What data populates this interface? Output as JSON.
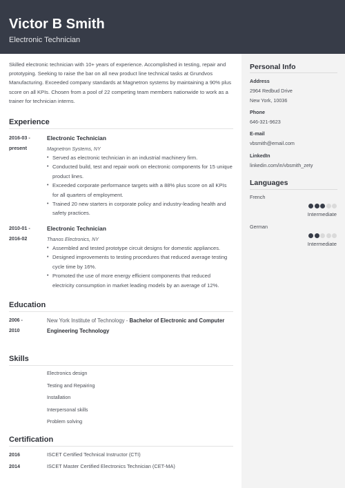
{
  "header": {
    "name": "Victor B Smith",
    "title": "Electronic Technician"
  },
  "summary": "Skilled electronic technician with 10+ years of experience. Accomplished in testing, repair and prototyping. Seeking to raise the bar on all new product line technical tasks at Grundvos Manufacturing. Exceeded company standards at Magnetron systems by maintaining a 90% plus score on all KPIs. Chosen from a pool of 22 competing team members nationwide to work as a trainer for technician interns.",
  "experience": {
    "heading": "Experience",
    "jobs": [
      {
        "date_start": "2016-03 -",
        "date_end": "present",
        "title": "Electronic Technician",
        "company": "Magnetron Systems, NY",
        "bullets": [
          "Served as electronic technician in an industrial machinery firm.",
          "Conducted build, test and repair work on electronic components for 15 unique product lines.",
          "Exceeded corporate performance targets with a 88% plus score on all KPIs for all quarters of employment.",
          "Trained 20 new starters in corporate policy and industry-leading health and safety practices."
        ]
      },
      {
        "date_start": "2010-01 -",
        "date_end": "2016-02",
        "title": "Electronic Technician",
        "company": "Thanos Electronics, NY",
        "bullets": [
          "Assembled and tested prototype circuit designs for domestic appliances.",
          "Designed improvements to testing procedures that reduced average testing cycle time by 16%.",
          "Promoted the use of more energy efficient components that reduced electricity consumption in market leading models by an average of 12%."
        ]
      }
    ]
  },
  "education": {
    "heading": "Education",
    "items": [
      {
        "date_start": "2006 -",
        "date_end": "2010",
        "school": "New York Institute of Technology - ",
        "degree": "Bachelor of Electronic and Computer Engineering Technology"
      }
    ]
  },
  "skills": {
    "heading": "Skills",
    "items": [
      "Electronics design",
      "Testing and  Repairing",
      "Installation",
      "Interpersonal skills",
      "Problem solving"
    ]
  },
  "certification": {
    "heading": "Certification",
    "items": [
      {
        "year": "2016",
        "name": "ISCET Certified Technical Instructor (CTI)"
      },
      {
        "year": "2014",
        "name": "ISCET Master Certified Electronics Technician (CET-MA)"
      }
    ]
  },
  "sidebar": {
    "personal_info": {
      "heading": "Personal Info",
      "address_label": "Address",
      "address_line1": "2964 Redbud Drive",
      "address_line2": "New York, 10036",
      "phone_label": "Phone",
      "phone": "646-321-9623",
      "email_label": "E-mail",
      "email": "vbsmith@email.com",
      "linkedin_label": "LinkedIn",
      "linkedin": "linkedin.com/in/vbsmith_zety"
    },
    "languages": {
      "heading": "Languages",
      "items": [
        {
          "name": "French",
          "level": "Intermediate",
          "rating": 3,
          "max": 5
        },
        {
          "name": "German",
          "level": "Intermediate",
          "rating": 2,
          "max": 5
        }
      ]
    }
  },
  "colors": {
    "header_bg": "#373c48",
    "sidebar_bg": "#f3f3f3",
    "dot_on": "#373c48",
    "dot_off": "#dadada"
  }
}
